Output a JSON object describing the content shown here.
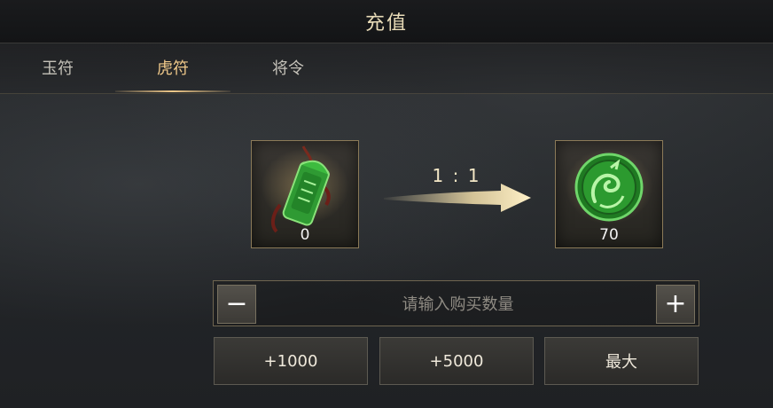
{
  "header": {
    "title": "充值"
  },
  "tabs": [
    {
      "label": "玉符",
      "active": false
    },
    {
      "label": "虎符",
      "active": true
    },
    {
      "label": "将令",
      "active": false
    }
  ],
  "exchange": {
    "source": {
      "icon": "jade-tally-icon",
      "count": "0"
    },
    "ratio": "1 : 1",
    "target": {
      "icon": "dragon-coin-icon",
      "count": "70"
    }
  },
  "quantity": {
    "placeholder": "请输入购买数量",
    "minus_label": "−",
    "plus_label": "+"
  },
  "quick_buttons": [
    "+1000",
    "+5000",
    "最大"
  ],
  "colors": {
    "accent": "#f0c98a",
    "title": "#e9dcb8",
    "jade": "#3fae3f",
    "frame": "#8b7a58"
  }
}
